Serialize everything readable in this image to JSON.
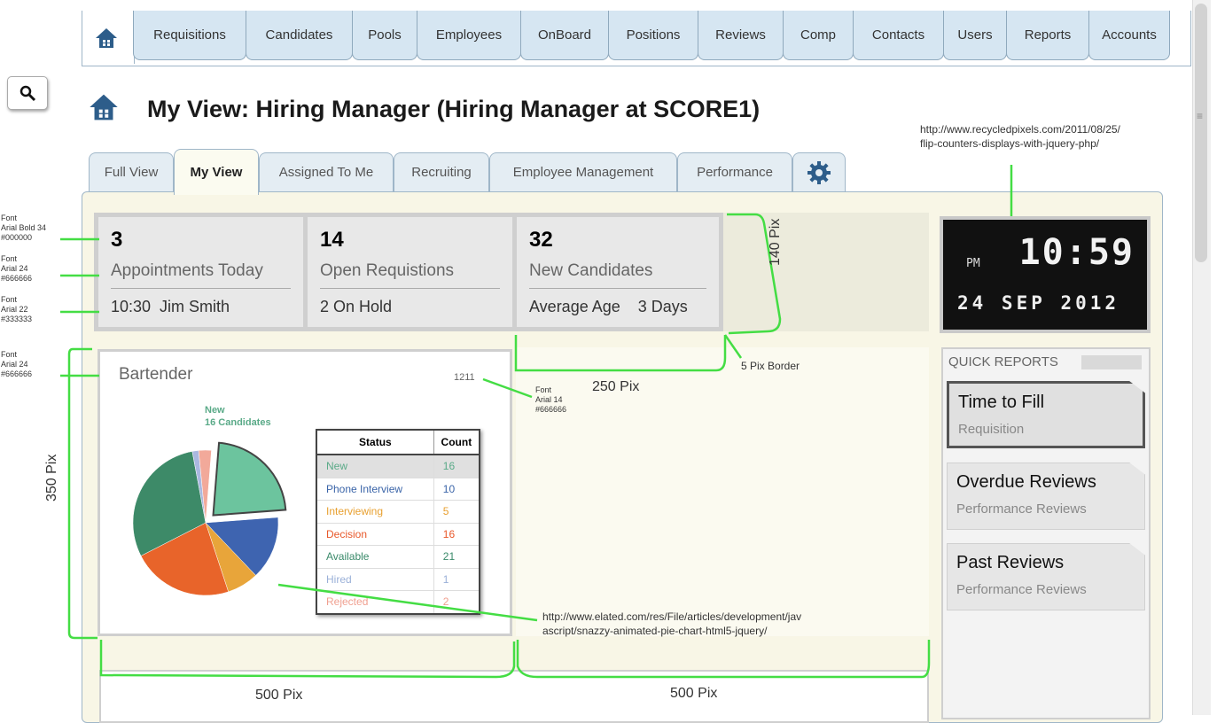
{
  "nav": {
    "tabs": [
      "Requisitions",
      "Candidates",
      "Pools",
      "Employees",
      "OnBoard",
      "Positions",
      "Reviews",
      "Comp",
      "Contacts",
      "Users",
      "Reports",
      "Accounts"
    ]
  },
  "page": {
    "title": "My View: Hiring Manager (Hiring Manager at SCORE1)"
  },
  "subtabs": [
    "Full View",
    "My View",
    "Assigned To Me",
    "Recruiting",
    "Employee Management",
    "Performance"
  ],
  "stats": [
    {
      "number": "3",
      "label": "Appointments Today",
      "sub": "10:30  Jim Smith"
    },
    {
      "number": "14",
      "label": "Open Requistions",
      "sub": "2 On Hold"
    },
    {
      "number": "32",
      "label": "New Candidates",
      "sub": "Average Age    3 Days"
    }
  ],
  "widget": {
    "title": "Bartender",
    "code": "1211",
    "callout_line1": "New",
    "callout_line2": "16 Candidates",
    "table_headers": [
      "Status",
      "Count"
    ],
    "table_rows": [
      {
        "status": "New",
        "count": "16",
        "color": "#5aaa88"
      },
      {
        "status": "Phone Interview",
        "count": "10",
        "color": "#3a64a8"
      },
      {
        "status": "Interviewing",
        "count": "5",
        "color": "#e8a030"
      },
      {
        "status": "Decision",
        "count": "16",
        "color": "#e8582a"
      },
      {
        "status": "Available",
        "count": "21",
        "color": "#3a8a6a"
      },
      {
        "status": "Hired",
        "count": "1",
        "color": "#9ab0d8"
      },
      {
        "status": "Rejected",
        "count": "2",
        "color": "#f0a090"
      }
    ]
  },
  "chart_data": {
    "type": "pie",
    "categories": [
      "New",
      "Phone Interview",
      "Interviewing",
      "Decision",
      "Available",
      "Hired",
      "Rejected"
    ],
    "values": [
      16,
      10,
      5,
      16,
      21,
      1,
      2
    ],
    "colors": [
      "#6cc49e",
      "#3e64b0",
      "#e8a53a",
      "#e8642a",
      "#3d8a68",
      "#aab8e0",
      "#f2a99a"
    ]
  },
  "clock": {
    "ampm": "PM",
    "time": "10:59",
    "date": "24 SEP 2012"
  },
  "quick_reports": {
    "heading": "QUICK REPORTS",
    "items": [
      {
        "title": "Time to Fill",
        "subtitle": "Requisition"
      },
      {
        "title": "Overdue Reviews",
        "subtitle": "Performance Reviews"
      },
      {
        "title": "Past Reviews",
        "subtitle": "Performance Reviews"
      }
    ]
  },
  "annotations": {
    "font1": "Font\nArial Bold 34\n#000000",
    "font2": "Font\nArial 24\n#666666",
    "font3": "Font\nArial 22\n#333333",
    "font4": "Font\nArial 24\n#666666",
    "font5": "Font\nArial 14\n#666666",
    "h140": "140 Pix",
    "h350": "350 Pix",
    "w250": "250 Pix",
    "border5": "5 Pix Border",
    "w500a": "500 Pix",
    "w500b": "500 Pix",
    "url_clock": "http://www.recycledpixels.com/2011/08/25/\nflip-counters-displays-with-jquery-php/",
    "url_pie": "http://www.elated.com/res/File/articles/development/jav\nascript/snazzy-animated-pie-chart-html5-jquery/"
  }
}
